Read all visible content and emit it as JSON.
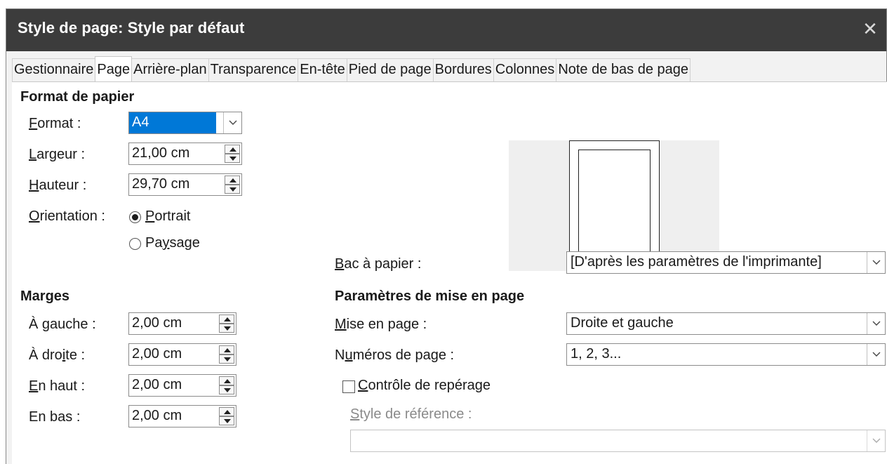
{
  "window": {
    "title": "Style de page: Style par défaut",
    "close_glyph": "✕"
  },
  "tabs": [
    {
      "label": "Gestionnaire",
      "active": false
    },
    {
      "label": "Page",
      "active": true
    },
    {
      "label": "Arrière-plan",
      "active": false
    },
    {
      "label": "Transparence",
      "active": false
    },
    {
      "label": "En-tête",
      "active": false
    },
    {
      "label": "Pied de page",
      "active": false
    },
    {
      "label": "Bordures",
      "active": false
    },
    {
      "label": "Colonnes",
      "active": false
    },
    {
      "label": "Note de bas de page",
      "active": false
    }
  ],
  "paper": {
    "section_title": "Format de papier",
    "format_label_u": "F",
    "format_label_rest": "ormat :",
    "format_value": "A4",
    "width_label_u": "L",
    "width_label_rest": "argeur :",
    "width_value": "21,00 cm",
    "height_label_u": "H",
    "height_label_rest": "auteur :",
    "height_value": "29,70 cm",
    "orientation_label_u": "O",
    "orientation_label_rest": "rientation :",
    "portrait_u": "P",
    "portrait_rest": "ortrait",
    "portrait_selected": true,
    "landscape_pre": "Pa",
    "landscape_u": "y",
    "landscape_rest": "sage",
    "landscape_selected": false
  },
  "tray": {
    "label_u": "B",
    "label_rest": "ac à papier :",
    "value": "[D'après les paramètres de l'imprimante]"
  },
  "margins": {
    "section_title": "Marges",
    "left_pre": "À ",
    "left_u": "g",
    "left_rest": "auche :",
    "left_value": "2,00 cm",
    "right_pre": "À dro",
    "right_u": "i",
    "right_rest": "te :",
    "right_value": "2,00 cm",
    "top_u": "E",
    "top_rest": "n haut :",
    "top_value": "2,00 cm",
    "bottom_label": "En bas :",
    "bottom_value": "2,00 cm"
  },
  "layout": {
    "section_title": "Paramètres de mise en page",
    "page_layout_u": "M",
    "page_layout_rest": "ise en page :",
    "page_layout_value": "Droite et gauche",
    "page_numbers_pre": "N",
    "page_numbers_u": "u",
    "page_numbers_rest": "méros de page :",
    "page_numbers_value": "1, 2, 3...",
    "register_u": "C",
    "register_rest": "ontrôle de repérage",
    "register_checked": false,
    "ref_style_u": "S",
    "ref_style_rest": "tyle de référence :",
    "ref_style_value": ""
  }
}
